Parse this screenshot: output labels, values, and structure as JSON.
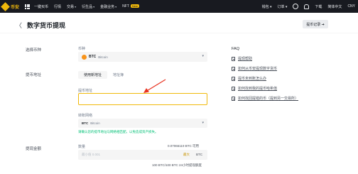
{
  "topbar": {
    "logo_text": "币安",
    "nav": [
      {
        "label": "一键买币",
        "caret": false,
        "badge": ""
      },
      {
        "label": "行情",
        "caret": false,
        "badge": ""
      },
      {
        "label": "交易",
        "caret": true,
        "badge": ""
      },
      {
        "label": "衍生品",
        "caret": true,
        "badge": ""
      },
      {
        "label": "金融业务",
        "caret": true,
        "badge": ""
      },
      {
        "label": "NFT",
        "caret": false,
        "badge": "New"
      }
    ],
    "right": {
      "wallet": "钱包",
      "orders": "订单",
      "download": "下载",
      "language": "简体中文",
      "currency": "CNY"
    }
  },
  "page": {
    "back": "〈",
    "title": "数字货币提现",
    "history_button": "提币记录 ➔"
  },
  "steps": {
    "coin": "选择币种",
    "address": "提币地址",
    "amount": "提现金额"
  },
  "coin_field": {
    "label": "币种",
    "code": "BTC",
    "name": "Bitcoin"
  },
  "address_tabs": [
    "使用新地址",
    "地址簿"
  ],
  "address_field": {
    "label": "提币地址",
    "value": ""
  },
  "network_field": {
    "label": "转账网络",
    "code": "BTC",
    "name": "Bitcoin"
  },
  "notice": "请确认您的提币地址与网络相匹配，以免造成资产损失。",
  "amount_field": {
    "label": "数量",
    "available": "0.07066119 BTC 可用",
    "placeholder": "最小值 0.001",
    "max": "最大",
    "unit": "BTC",
    "limit": "100 BTC/100 BTC 24小时提现额度"
  },
  "faq": {
    "title": "FAQ",
    "items": [
      "提现帮助",
      "如何从币安提现数字货币",
      "提币未到账怎么办",
      "如何找到我的提币哈希值",
      "如何找回提错的币（提到另一交易所）"
    ]
  },
  "colors": {
    "accent": "#f0b90b",
    "topbar": "#181a20",
    "success": "#02c076",
    "annotation": "#e8321f"
  }
}
